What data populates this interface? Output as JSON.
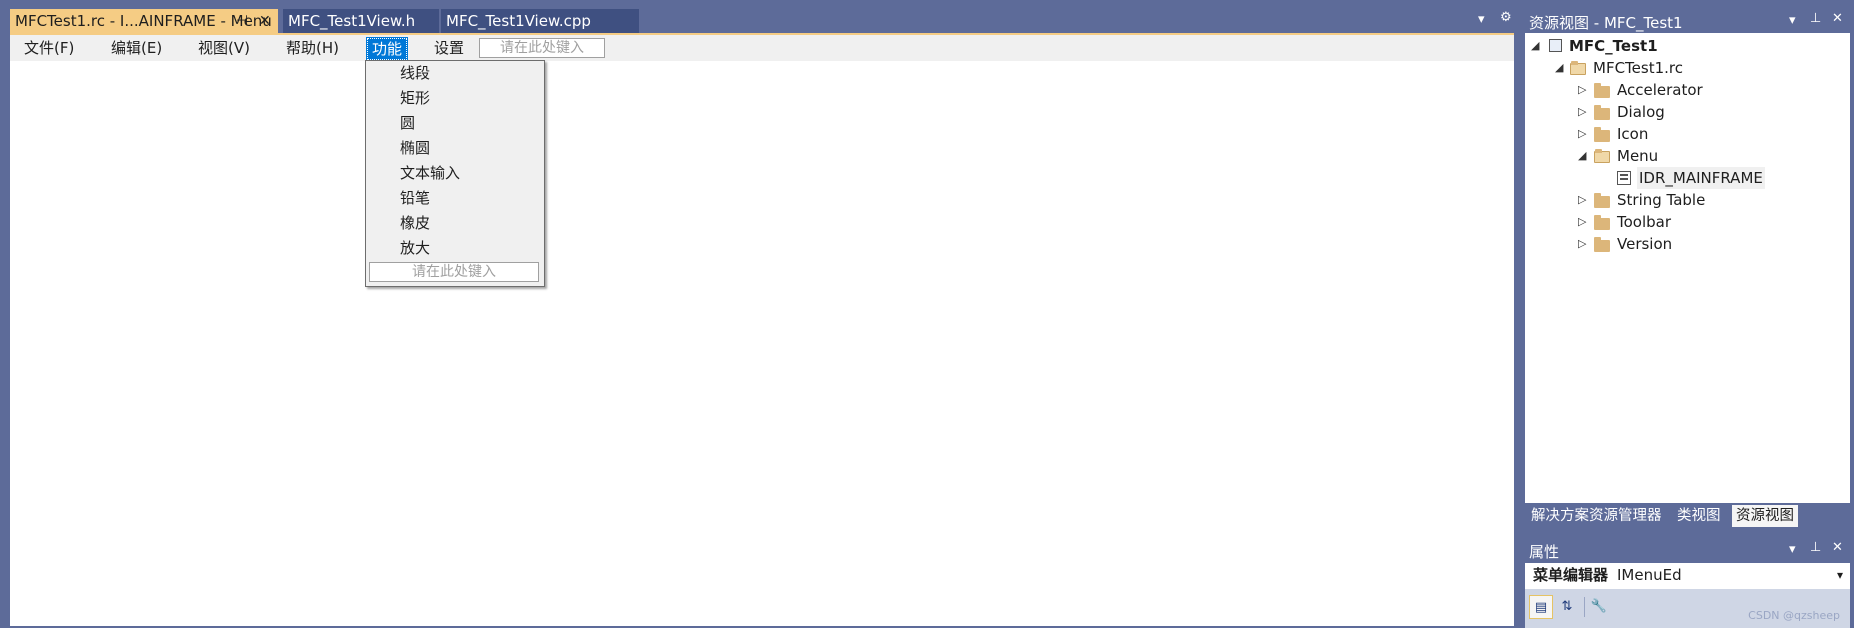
{
  "doc_tabs": [
    {
      "label": "MFCTest1.rc - I...AINFRAME - Menu",
      "active": true
    },
    {
      "label": "MFC_Test1View.h",
      "active": false
    },
    {
      "label": "MFC_Test1View.cpp",
      "active": false
    }
  ],
  "doc_tab_icons": {
    "pin": "⊣",
    "close": "✕",
    "dropdown": "▾",
    "settings": "⚙"
  },
  "menubar": {
    "items": [
      {
        "label": "文件(F)"
      },
      {
        "label": "编辑(E)"
      },
      {
        "label": "视图(V)"
      },
      {
        "label": "帮助(H)"
      },
      {
        "label": "功能",
        "selected": true
      },
      {
        "label": "设置"
      }
    ],
    "type_here": "请在此处键入"
  },
  "dropdown": {
    "items": [
      "线段",
      "矩形",
      "圆",
      "椭圆",
      "文本输入",
      "铅笔",
      "橡皮",
      "放大"
    ],
    "type_here": "请在此处键入"
  },
  "resource_view": {
    "title": "资源视图 - MFC_Test1",
    "icons": {
      "dropdown": "▾",
      "pin": "⊥",
      "close": "✕"
    },
    "tree": [
      {
        "label": "MFC_Test1",
        "level": 0,
        "expanded": true,
        "bold": true,
        "icon": "project-icon"
      },
      {
        "label": "MFCTest1.rc",
        "level": 1,
        "expanded": true,
        "icon": "open-folder-icon"
      },
      {
        "label": "Accelerator",
        "level": 2,
        "expanded": false,
        "icon": "folder-icon"
      },
      {
        "label": "Dialog",
        "level": 2,
        "expanded": false,
        "icon": "folder-icon"
      },
      {
        "label": "Icon",
        "level": 2,
        "expanded": false,
        "icon": "folder-icon"
      },
      {
        "label": "Menu",
        "level": 2,
        "expanded": true,
        "icon": "open-folder-icon"
      },
      {
        "label": "IDR_MAINFRAME",
        "level": 3,
        "icon": "menu-resource-icon",
        "selected": true
      },
      {
        "label": "String Table",
        "level": 2,
        "expanded": false,
        "icon": "folder-icon"
      },
      {
        "label": "Toolbar",
        "level": 2,
        "expanded": false,
        "icon": "folder-icon"
      },
      {
        "label": "Version",
        "level": 2,
        "expanded": false,
        "icon": "folder-icon"
      }
    ]
  },
  "bottom_tabs": [
    {
      "label": "解决方案资源管理器",
      "active": false
    },
    {
      "label": "类视图",
      "active": false
    },
    {
      "label": "资源视图",
      "active": true
    }
  ],
  "properties": {
    "title": "属性",
    "icons": {
      "dropdown": "▾",
      "pin": "⊥",
      "close": "✕"
    },
    "object_label": "菜单编辑器",
    "object_type": "IMenuEd",
    "dropdown_arrow": "▾"
  },
  "watermark": "CSDN @qzsheep",
  "colors": {
    "accent_tab": "#f5cc84",
    "chrome": "#5d6b99",
    "inactive_tab": "#3f5081",
    "selection": "#0078d7"
  }
}
